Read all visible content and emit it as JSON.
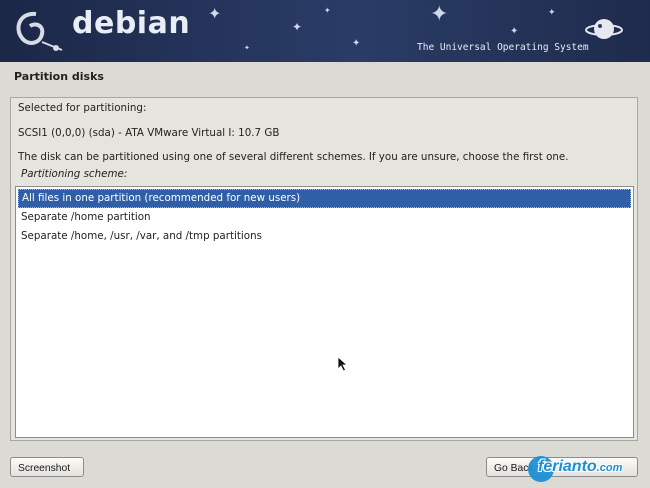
{
  "banner": {
    "brand": "debian",
    "tagline": "The Universal Operating System"
  },
  "page": {
    "title": "Partition disks"
  },
  "content": {
    "selected_label": "Selected for partitioning:",
    "disk": "SCSI1 (0,0,0) (sda) - ATA VMware Virtual I: 10.7 GB",
    "description": "The disk can be partitioned using one of several different schemes. If you are unsure, choose the first one.",
    "scheme_label": "Partitioning scheme:",
    "options": [
      "All files in one partition (recommended for new users)",
      "Separate /home partition",
      "Separate /home, /usr, /var, and /tmp partitions"
    ],
    "selected_index": 0
  },
  "buttons": {
    "screenshot": "Screenshot",
    "go_back": "Go Back"
  },
  "watermark": {
    "text": "ferianto",
    "suffix": ".com"
  }
}
